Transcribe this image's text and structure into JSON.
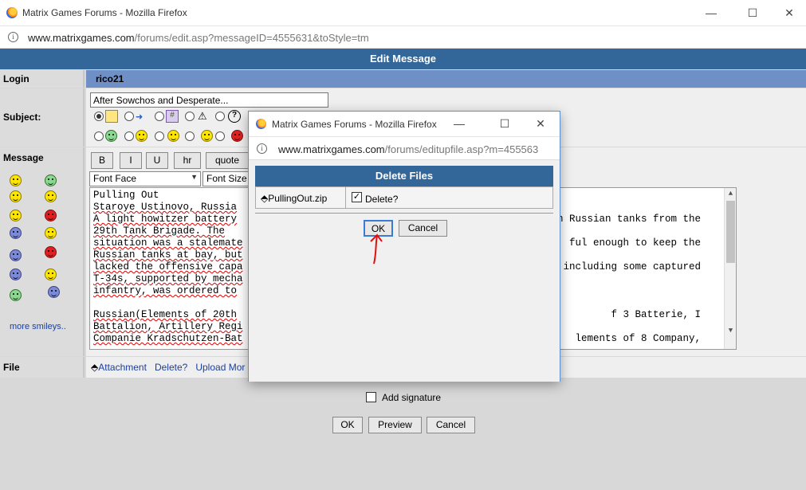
{
  "window": {
    "title": "Matrix Games Forums - Mozilla Firefox",
    "url_host": "www.matrixgames.com",
    "url_path": "/forums/edit.asp?messageID=4555631&toStyle=tm",
    "controls": {
      "minimize": "—",
      "maximize": "☐",
      "close": "✕"
    }
  },
  "page": {
    "header": "Edit Message",
    "login_label": "Login",
    "login_value": "rico21",
    "subject_label": "Subject:",
    "subject_value": "After Sowchos and Desperate...",
    "message_label": "Message",
    "format_buttons": [
      "B",
      "I",
      "U",
      "hr",
      "quote"
    ],
    "font_face": "Font Face",
    "font_size": "Font Size",
    "more_smileys": "more smileys..",
    "message_lines": [
      [
        "Pulling Out",
        ""
      ],
      [
        "Staroye Ustinovo, Russia",
        ""
      ],
      [
        "A light howitzer battery",
        "n Russian tanks from the"
      ],
      [
        "29th Tank Brigade. The",
        ""
      ],
      [
        "situation was a stalemate",
        "ful enough to keep the"
      ],
      [
        "Russian tanks at bay, but",
        ""
      ],
      [
        "lacked the offensive capa",
        "including some captured"
      ],
      [
        "T-34s, supported by mecha",
        ""
      ],
      [
        "infantry, was ordered to",
        ""
      ],
      [
        "",
        ""
      ],
      [
        "Russian(Elements of 20th",
        "f 3 Batterie, I"
      ],
      [
        "Battalion, Artillery Regi",
        ""
      ],
      [
        "Companie Kradschutzen-Bat",
        "lements of 8 Company,"
      ],
      [
        "",
        ""
      ]
    ],
    "file_label": "File",
    "attachment_label": "Attachment",
    "delete_label": "Delete?",
    "upload_label": "Upload Mor",
    "add_signature": "Add signature",
    "ok": "OK",
    "preview": "Preview",
    "cancel": "Cancel"
  },
  "popup": {
    "title": "Matrix Games Forums - Mozilla Firefox",
    "url_host": "www.matrixgames.com",
    "url_path": "/forums/editupfile.asp?m=455563",
    "header": "Delete Files",
    "filename": "PullingOut.zip",
    "delete_label": "Delete?",
    "delete_checked": true,
    "ok": "OK",
    "cancel": "Cancel"
  }
}
